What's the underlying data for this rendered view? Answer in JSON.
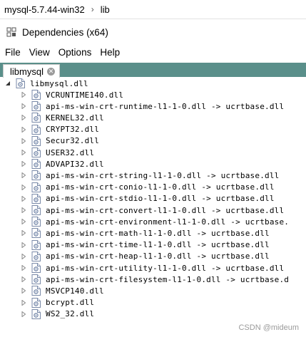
{
  "breadcrumb": {
    "items": [
      "mysql-5.7.44-win32",
      "lib"
    ],
    "separator": "›"
  },
  "window": {
    "title": "Dependencies (x64)"
  },
  "menu": {
    "items": [
      "File",
      "View",
      "Options",
      "Help"
    ]
  },
  "tabs": [
    {
      "label": "libmysql"
    }
  ],
  "tree": {
    "root": {
      "label": "libmysql.dll",
      "expanded": true
    },
    "children": [
      "VCRUNTIME140.dll",
      "api-ms-win-crt-runtime-l1-1-0.dll -> ucrtbase.dll",
      "KERNEL32.dll",
      "CRYPT32.dll",
      "Secur32.dll",
      "USER32.dll",
      "ADVAPI32.dll",
      "api-ms-win-crt-string-l1-1-0.dll -> ucrtbase.dll",
      "api-ms-win-crt-conio-l1-1-0.dll -> ucrtbase.dll",
      "api-ms-win-crt-stdio-l1-1-0.dll -> ucrtbase.dll",
      "api-ms-win-crt-convert-l1-1-0.dll -> ucrtbase.dll",
      "api-ms-win-crt-environment-l1-1-0.dll -> ucrtbase.",
      "api-ms-win-crt-math-l1-1-0.dll -> ucrtbase.dll",
      "api-ms-win-crt-time-l1-1-0.dll -> ucrtbase.dll",
      "api-ms-win-crt-heap-l1-1-0.dll -> ucrtbase.dll",
      "api-ms-win-crt-utility-l1-1-0.dll -> ucrtbase.dll",
      "api-ms-win-crt-filesystem-l1-1-0.dll -> ucrtbase.d",
      "MSVCP140.dll",
      "bcrypt.dll",
      "WS2_32.dll"
    ]
  },
  "watermark": "CSDN @mideum",
  "colors": {
    "tabstrip": "#5a8f8a",
    "icon": "#6b7fa3"
  }
}
